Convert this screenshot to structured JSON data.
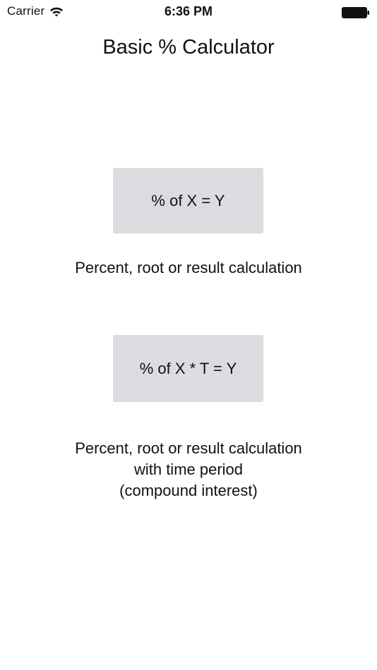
{
  "status_bar": {
    "carrier": "Carrier",
    "time": "6:36 PM",
    "wifi_icon": "wifi-icon",
    "battery_icon": "battery-full-icon"
  },
  "header": {
    "title": "Basic % Calculator"
  },
  "options": [
    {
      "button_label": "% of X = Y",
      "description_lines": [
        "Percent, root or result calculation"
      ]
    },
    {
      "button_label": "% of X * T = Y",
      "description_lines": [
        "Percent, root or result calculation",
        "with time period",
        "(compound interest)"
      ]
    }
  ],
  "colors": {
    "button_background": "#dcdce0",
    "text": "#111111",
    "background": "#ffffff"
  }
}
